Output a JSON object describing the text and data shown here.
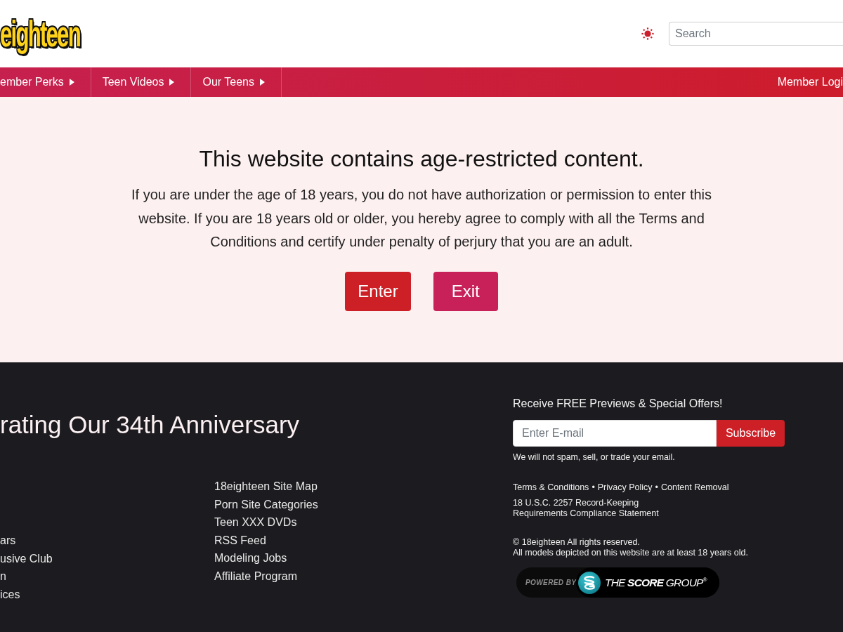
{
  "header": {
    "logo": "eighteen",
    "search": {
      "placeholder": "Search"
    }
  },
  "nav": {
    "items": [
      {
        "label": "ember Perks",
        "submenu": true
      },
      {
        "label": "Teen Videos",
        "submenu": true
      },
      {
        "label": "Our Teens",
        "submenu": true
      }
    ],
    "login": "Member Logi"
  },
  "age_gate": {
    "title": "This website contains age-restricted content.",
    "message": "If you are under the age of 18 years, you do not have authorization or permission to enter this website. If you are 18 years old or older, you hereby agree to comply with all the Terms and Conditions and certify under penalty of perjury that you are an adult.",
    "buttons": [
      {
        "label": "Enter",
        "kind": "enter"
      },
      {
        "label": "Exit",
        "kind": "exit"
      }
    ]
  },
  "footer": {
    "heading": "rating Our 34th Anniversary",
    "links_column_1": [
      "ars",
      "usive Club",
      "n",
      "ices"
    ],
    "links_column_2": [
      "18eighteen Site Map",
      "Porn Site Categories",
      "Teen XXX DVDs",
      "RSS Feed",
      "Modeling Jobs",
      "Affiliate Program"
    ],
    "newsletter": {
      "title": "Receive FREE Previews & Special Offers!",
      "email": {
        "placeholder": "Enter E-mail"
      },
      "button": "Subscribe",
      "note": "We will not spam, sell, or trade your email."
    },
    "legal_links": [
      "Terms & Conditions",
      "Privacy Policy",
      "Content Removal"
    ],
    "legal_separator": "•",
    "compliance_link": "18 U.S.C. 2257 Record-Keeping Requirements Compliance Statement",
    "copyright": "© 18eighteen All rights reserved.",
    "models_notice": "All models depicted on this website are at least 18 years old.",
    "powered_by": {
      "label": "POWERED BY",
      "brand": "THE **SCORE** GROUP$^{®}$"
    }
  }
}
